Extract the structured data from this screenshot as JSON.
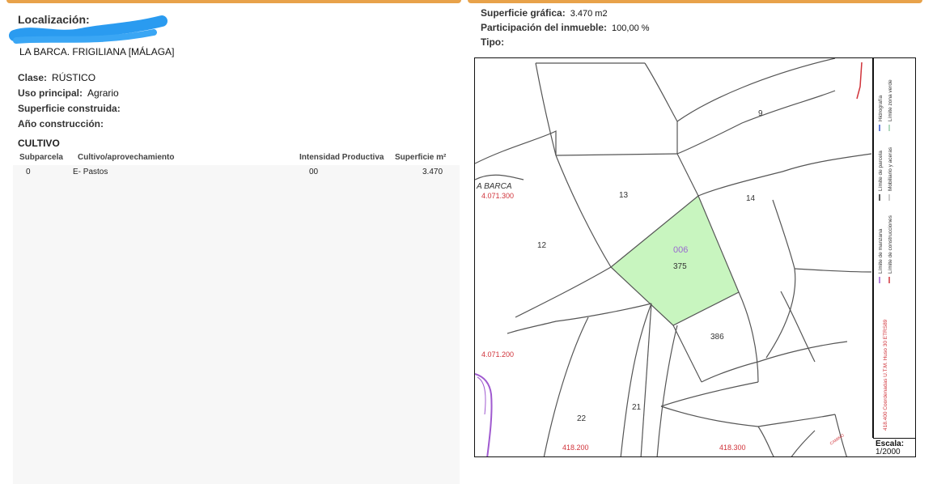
{
  "left": {
    "localizacion_label": "Localización:",
    "localizacion_value": "LA BARCA. FRIGILIANA [MÁLAGA]",
    "clase_label": "Clase:",
    "clase_value": "RÚSTICO",
    "uso_label": "Uso principal:",
    "uso_value": "Agrario",
    "superficie_construida_label": "Superficie construida:",
    "anio_label": "Año construcción:",
    "cultivo_title": "CULTIVO",
    "table": {
      "headers": [
        "Subparcela",
        "Cultivo/aprovechamiento",
        "Intensidad Productiva",
        "Superficie m²"
      ],
      "rows": [
        [
          "0",
          "E- Pastos",
          "00",
          "3.470"
        ]
      ]
    }
  },
  "right": {
    "superficie_grafica_label": "Superficie gráfica:",
    "superficie_grafica_value": "3.470 m2",
    "participacion_label": "Participación del inmueble:",
    "participacion_value": "100,00 %",
    "tipo_label": "Tipo:"
  },
  "map": {
    "place_label": "A BARCA",
    "coord_y1": "4.071.300",
    "coord_y2": "4.071.200",
    "coord_x1": "418.200",
    "coord_x2": "418.300",
    "camino": "CAMINO",
    "highlight_code": "006",
    "parcels": {
      "p9": "9",
      "p13": "13",
      "p14": "14",
      "p12": "12",
      "p375": "375",
      "p386": "386",
      "p22": "22",
      "p21": "21"
    },
    "legend": {
      "hidrografia": "Hidrografía",
      "zona_verde": "Límite zona verde",
      "parcela": "Límite de parcela",
      "mobiliario": "Mobiliario y aceras",
      "manzana": "Límite de manzana",
      "construcciones": "Límite de construcciones",
      "coordenadas": "418.400 Coordenadas U.T.M. Huso 30 ETRS89"
    },
    "escala_label": "Escala:",
    "escala_value": "1/2000",
    "colors": {
      "highlight_fill": "#c8f5bf",
      "parcel_line": "#555555",
      "coord_text": "#d0333a",
      "code_text": "#9a6ad0"
    }
  }
}
